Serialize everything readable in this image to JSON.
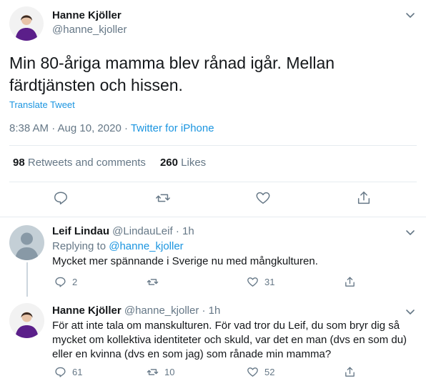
{
  "main_tweet": {
    "author_name": "Hanne Kjöller",
    "author_handle": "@hanne_kjoller",
    "text": "Min 80-åriga mamma blev rånad igår. Mellan färdtjänsten och hissen.",
    "translate_label": "Translate Tweet",
    "timestamp": "8:38 AM · Aug 10, 2020 · ",
    "source": "Twitter for iPhone",
    "retweets_count": "98",
    "retweets_label": "Retweets and comments",
    "likes_count": "260",
    "likes_label": "Likes",
    "actions": [
      "reply-icon",
      "retweet-icon",
      "like-icon",
      "share-icon"
    ]
  },
  "replies": [
    {
      "author_name": "Leif Lindau",
      "author_handle": "@LindauLeif",
      "time": "· 1h",
      "replying_prefix": "Replying to",
      "replying_to": "@hanne_kjoller",
      "text": "Mycket mer spännande i Sverige nu med mångkulturen.",
      "reply_count": "2",
      "retweet_count": "",
      "like_count": "31"
    },
    {
      "author_name": "Hanne Kjöller",
      "author_handle": "@hanne_kjoller",
      "time": "· 1h",
      "text": "För att inte tala om manskulturen. För vad tror du Leif, du som bryr dig så mycket om kollektiva identiteter och skuld, var det en man (dvs en som du) eller en kvinna (dvs en som jag) som rånade min mamma?",
      "reply_count": "61",
      "retweet_count": "10",
      "like_count": "52"
    }
  ],
  "colors": {
    "accent": "#1b95e0",
    "muted": "#657786",
    "text": "#14171a",
    "divider": "#e6ecf0",
    "avatar_purple": "#5b1f8a"
  }
}
